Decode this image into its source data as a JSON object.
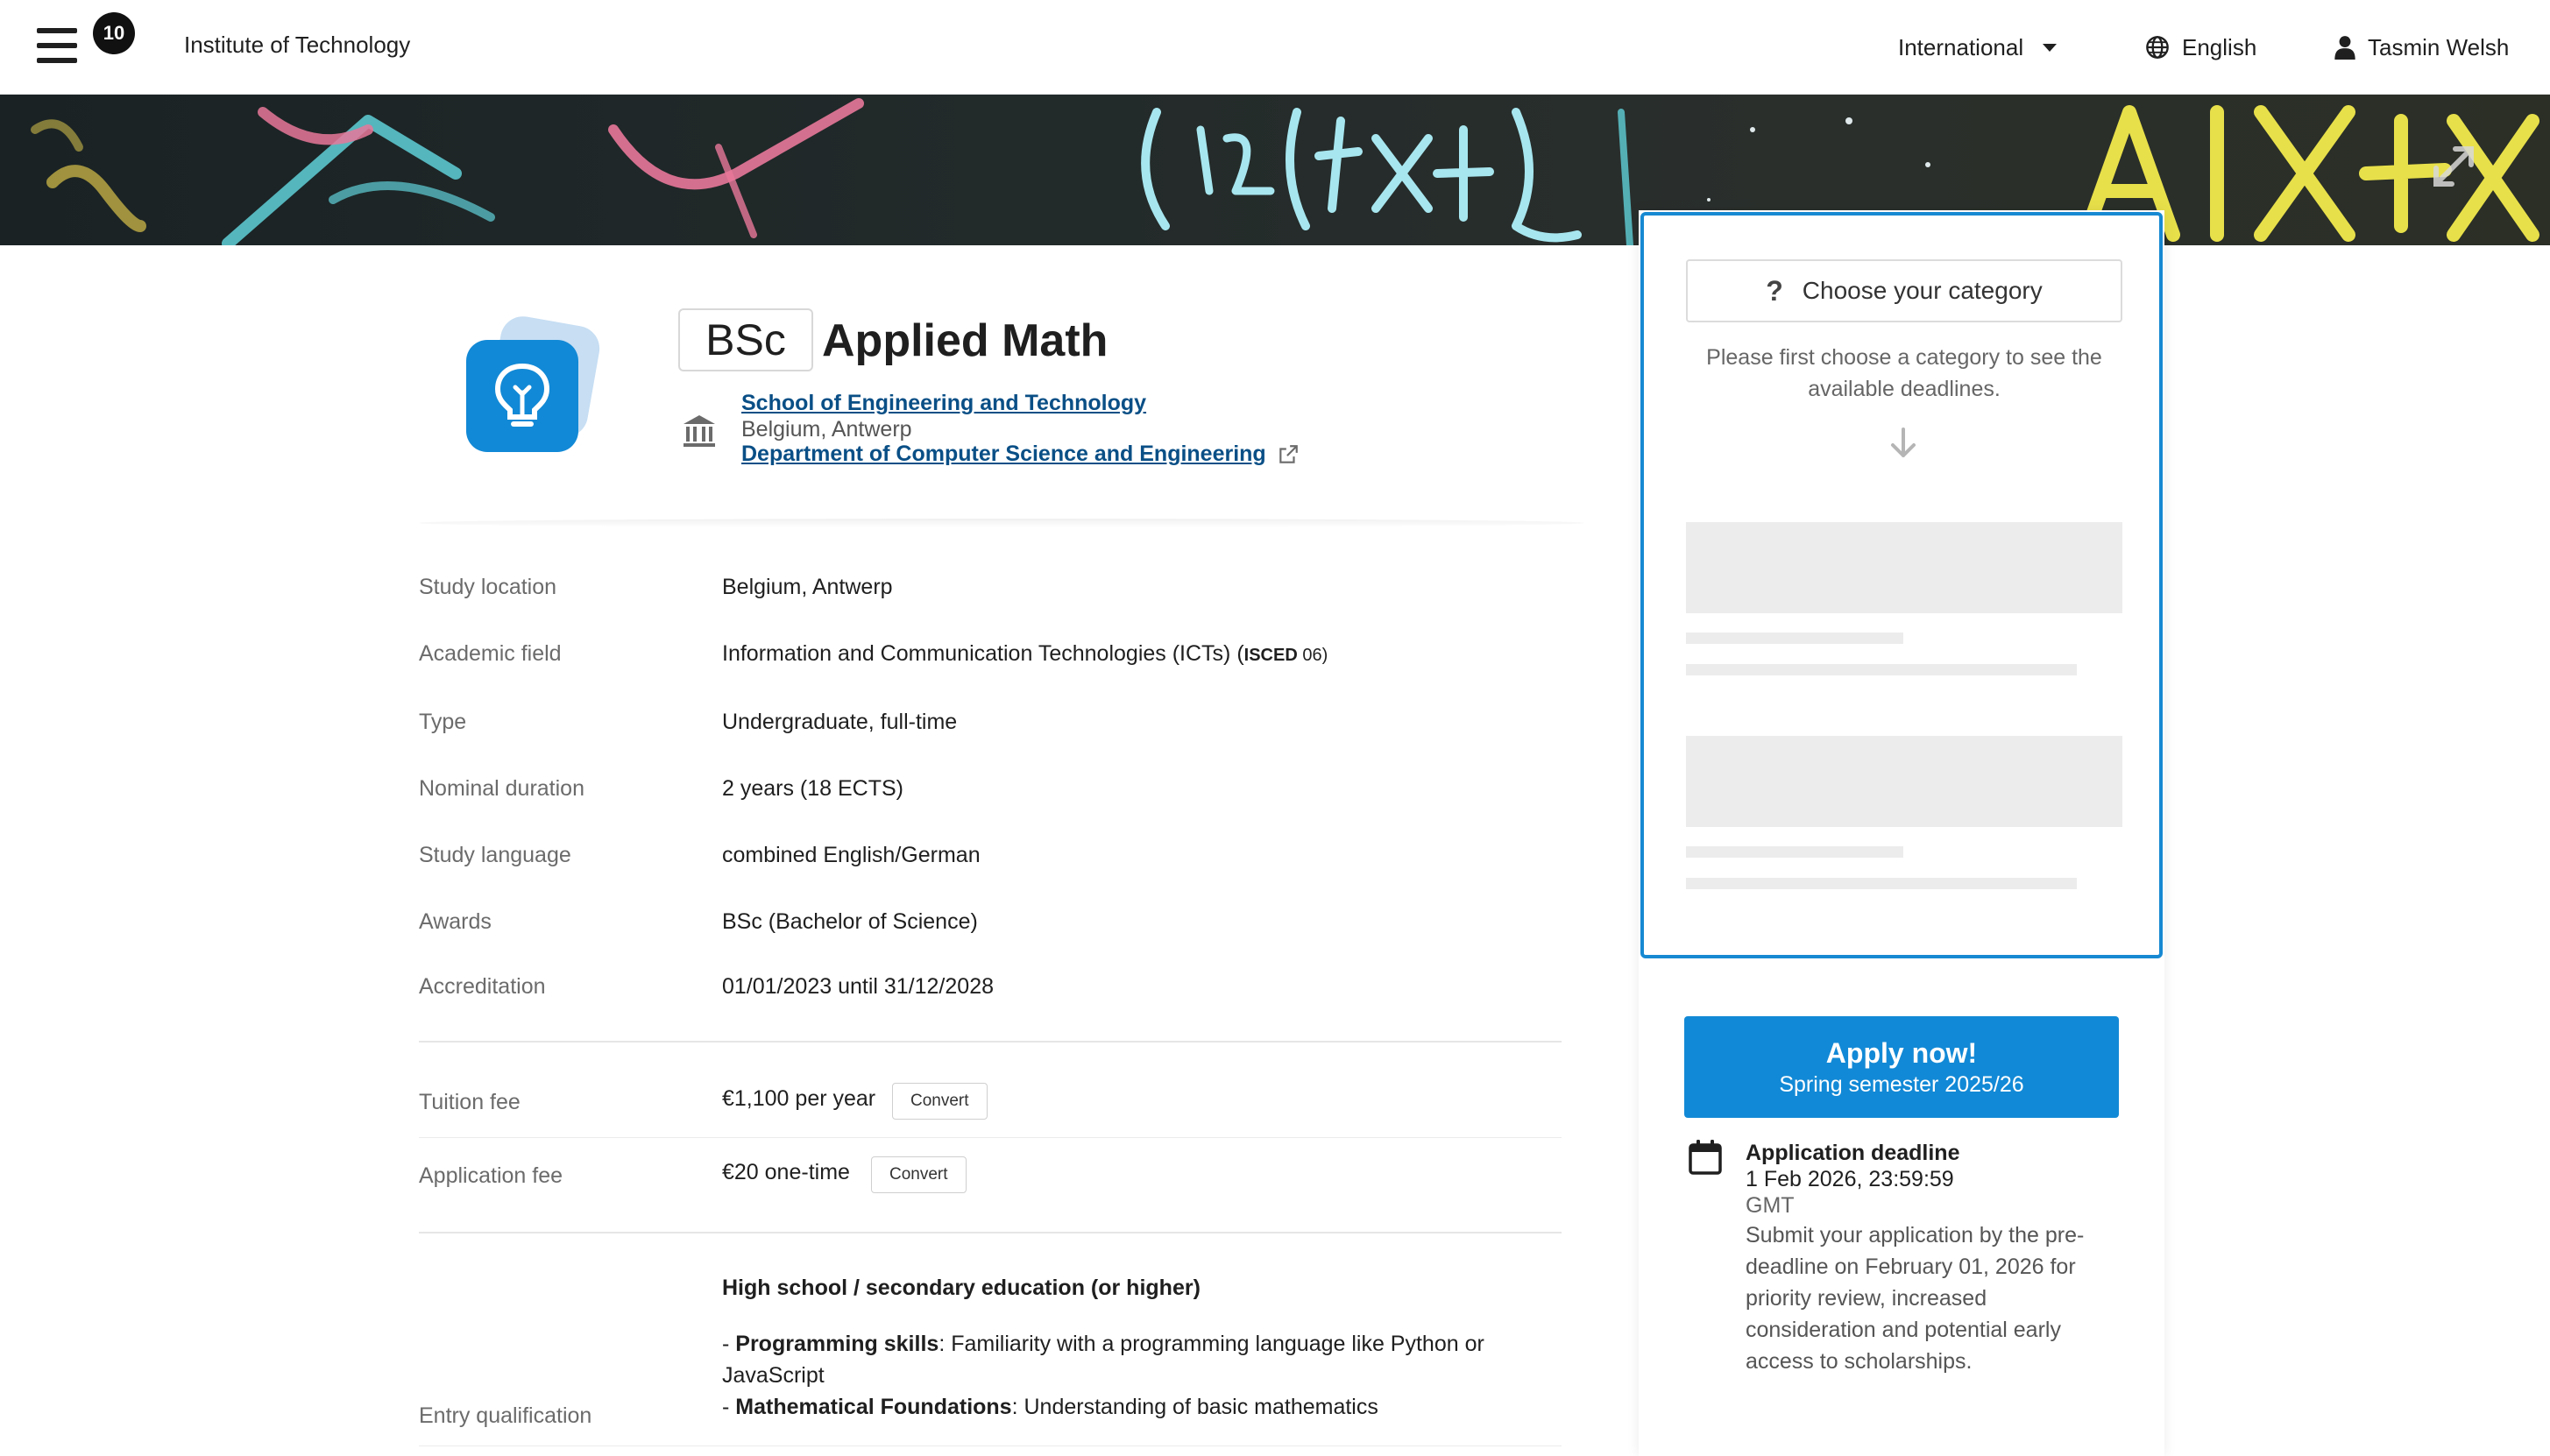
{
  "topbar": {
    "notification_count": "10",
    "org_name": "Institute of Technology",
    "region": "International",
    "language": "English",
    "user": "Tasmin Welsh"
  },
  "program": {
    "degree": "BSc",
    "title": "Applied Math",
    "school": "School of Engineering and Technology",
    "location": "Belgium, Antwerp",
    "department": "Department of Computer Science and Engineering"
  },
  "details": [
    {
      "label": "Study location",
      "value": "Belgium, Antwerp"
    },
    {
      "label": "Academic field",
      "value": "Information and Communication Technologies (ICTs)",
      "suffix_pre": " (",
      "suffix_code": "ISCED",
      "suffix_num": " 06)"
    },
    {
      "label": "Type",
      "value": "Undergraduate, full-time"
    },
    {
      "label": "Nominal duration",
      "value": "2 years (18 ECTS)"
    },
    {
      "label": "Study language",
      "value": "combined English/German"
    },
    {
      "label": "Awards",
      "value": "BSc (Bachelor of Science)"
    },
    {
      "label": "Accreditation",
      "value": "01/01/2023 until 31/12/2028"
    }
  ],
  "fees": {
    "tuition_label": "Tuition fee",
    "tuition_value": "€1,100 per year",
    "application_label": "Application fee",
    "application_value": "€20 one-time",
    "convert_label": "Convert"
  },
  "entry": {
    "label": "Entry qualification",
    "heading": "High school / secondary education (or higher)",
    "items": [
      {
        "bold": "Programming skills",
        "text": ": Familiarity with a programming language like Python or JavaScript"
      },
      {
        "bold": "Mathematical Foundations",
        "text": ": Understanding of basic mathematics"
      }
    ]
  },
  "sidebar": {
    "category_placeholder": "Choose your category",
    "category_hint": "Please first choose a category to see the available deadlines.",
    "apply_label": "Apply now!",
    "apply_semester": "Spring semester 2025/26",
    "deadline_title": "Application deadline",
    "deadline_date": "1 Feb 2026, 23:59:59",
    "deadline_tz": "GMT",
    "deadline_desc": "Submit your application by the pre-deadline on February 01, 2026 for priority review, increased consideration and potential early access to scholarships."
  },
  "colors": {
    "accent": "#1289d6",
    "link": "#0a4f86",
    "focus_border": "#1789d2"
  }
}
